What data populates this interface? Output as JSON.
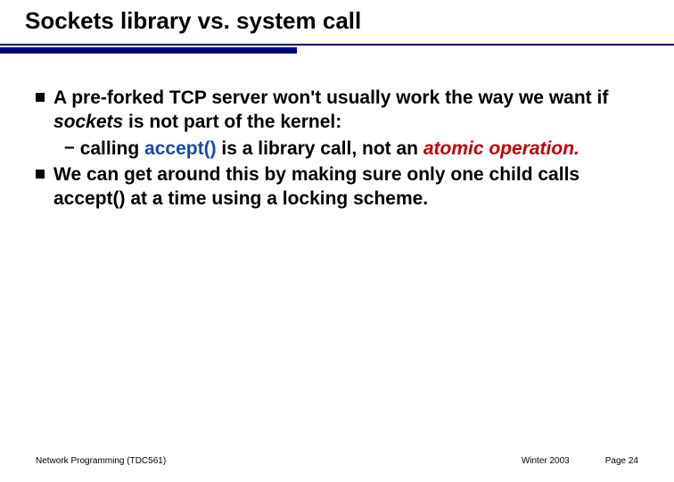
{
  "slide": {
    "title": "Sockets library vs. system call",
    "bullets": [
      {
        "pre": "A pre-forked TCP server won't usually work the way we want if ",
        "em": "sockets",
        "post": " is not part of the kernel:"
      },
      {
        "pre": "We can get around this by making sure only one child calls accept() at a time using a locking scheme.",
        "em": "",
        "post": ""
      }
    ],
    "sub": {
      "dash": "–",
      "t1": "calling ",
      "blue": "accept()",
      "t2": " is a library call, not an ",
      "red": "atomic operation.",
      "t3": ""
    }
  },
  "footer": {
    "left": "Network Programming (TDC561)",
    "mid": "Winter  2003",
    "right": "Page 24"
  }
}
